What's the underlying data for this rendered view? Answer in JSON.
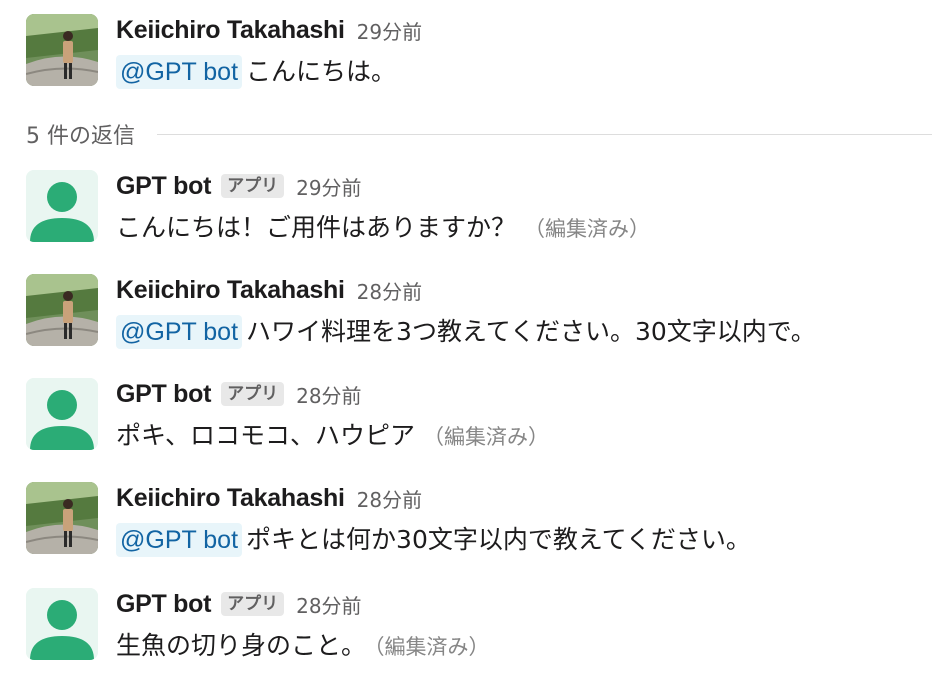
{
  "thread": {
    "reply_count_label": "5 件の返信"
  },
  "messages": [
    {
      "sender": "Keiichiro Takahashi",
      "time": "29分前",
      "mention": "@GPT bot",
      "text": "こんにちは。"
    },
    {
      "sender": "GPT bot",
      "badge": "アプリ",
      "time": "29分前",
      "text": "こんにちは！ご用件はありますか？",
      "edited": "（編集済み）"
    },
    {
      "sender": "Keiichiro Takahashi",
      "time": "28分前",
      "mention": "@GPT bot",
      "text": "ハワイ料理を3つ教えてください。30文字以内で。"
    },
    {
      "sender": "GPT bot",
      "badge": "アプリ",
      "time": "28分前",
      "text": "ポキ、ロコモコ、ハウピア",
      "edited": "（編集済み）"
    },
    {
      "sender": "Keiichiro Takahashi",
      "time": "28分前",
      "mention": "@GPT bot",
      "text": "ポキとは何か30文字以内で教えてください。"
    },
    {
      "sender": "GPT bot",
      "badge": "アプリ",
      "time": "28分前",
      "text": "生魚の切り身のこと。",
      "edited": "（編集済み）"
    }
  ],
  "colors": {
    "mention_bg": "#e8f5fa",
    "mention_text": "#1264a3",
    "bot_avatar": "#2bac76",
    "bot_avatar_bg": "#e9f6f1",
    "badge_bg": "#e8e8e8"
  },
  "icons": {
    "user_avatar": "user-photo-avatar",
    "bot_avatar": "person-silhouette-icon"
  }
}
